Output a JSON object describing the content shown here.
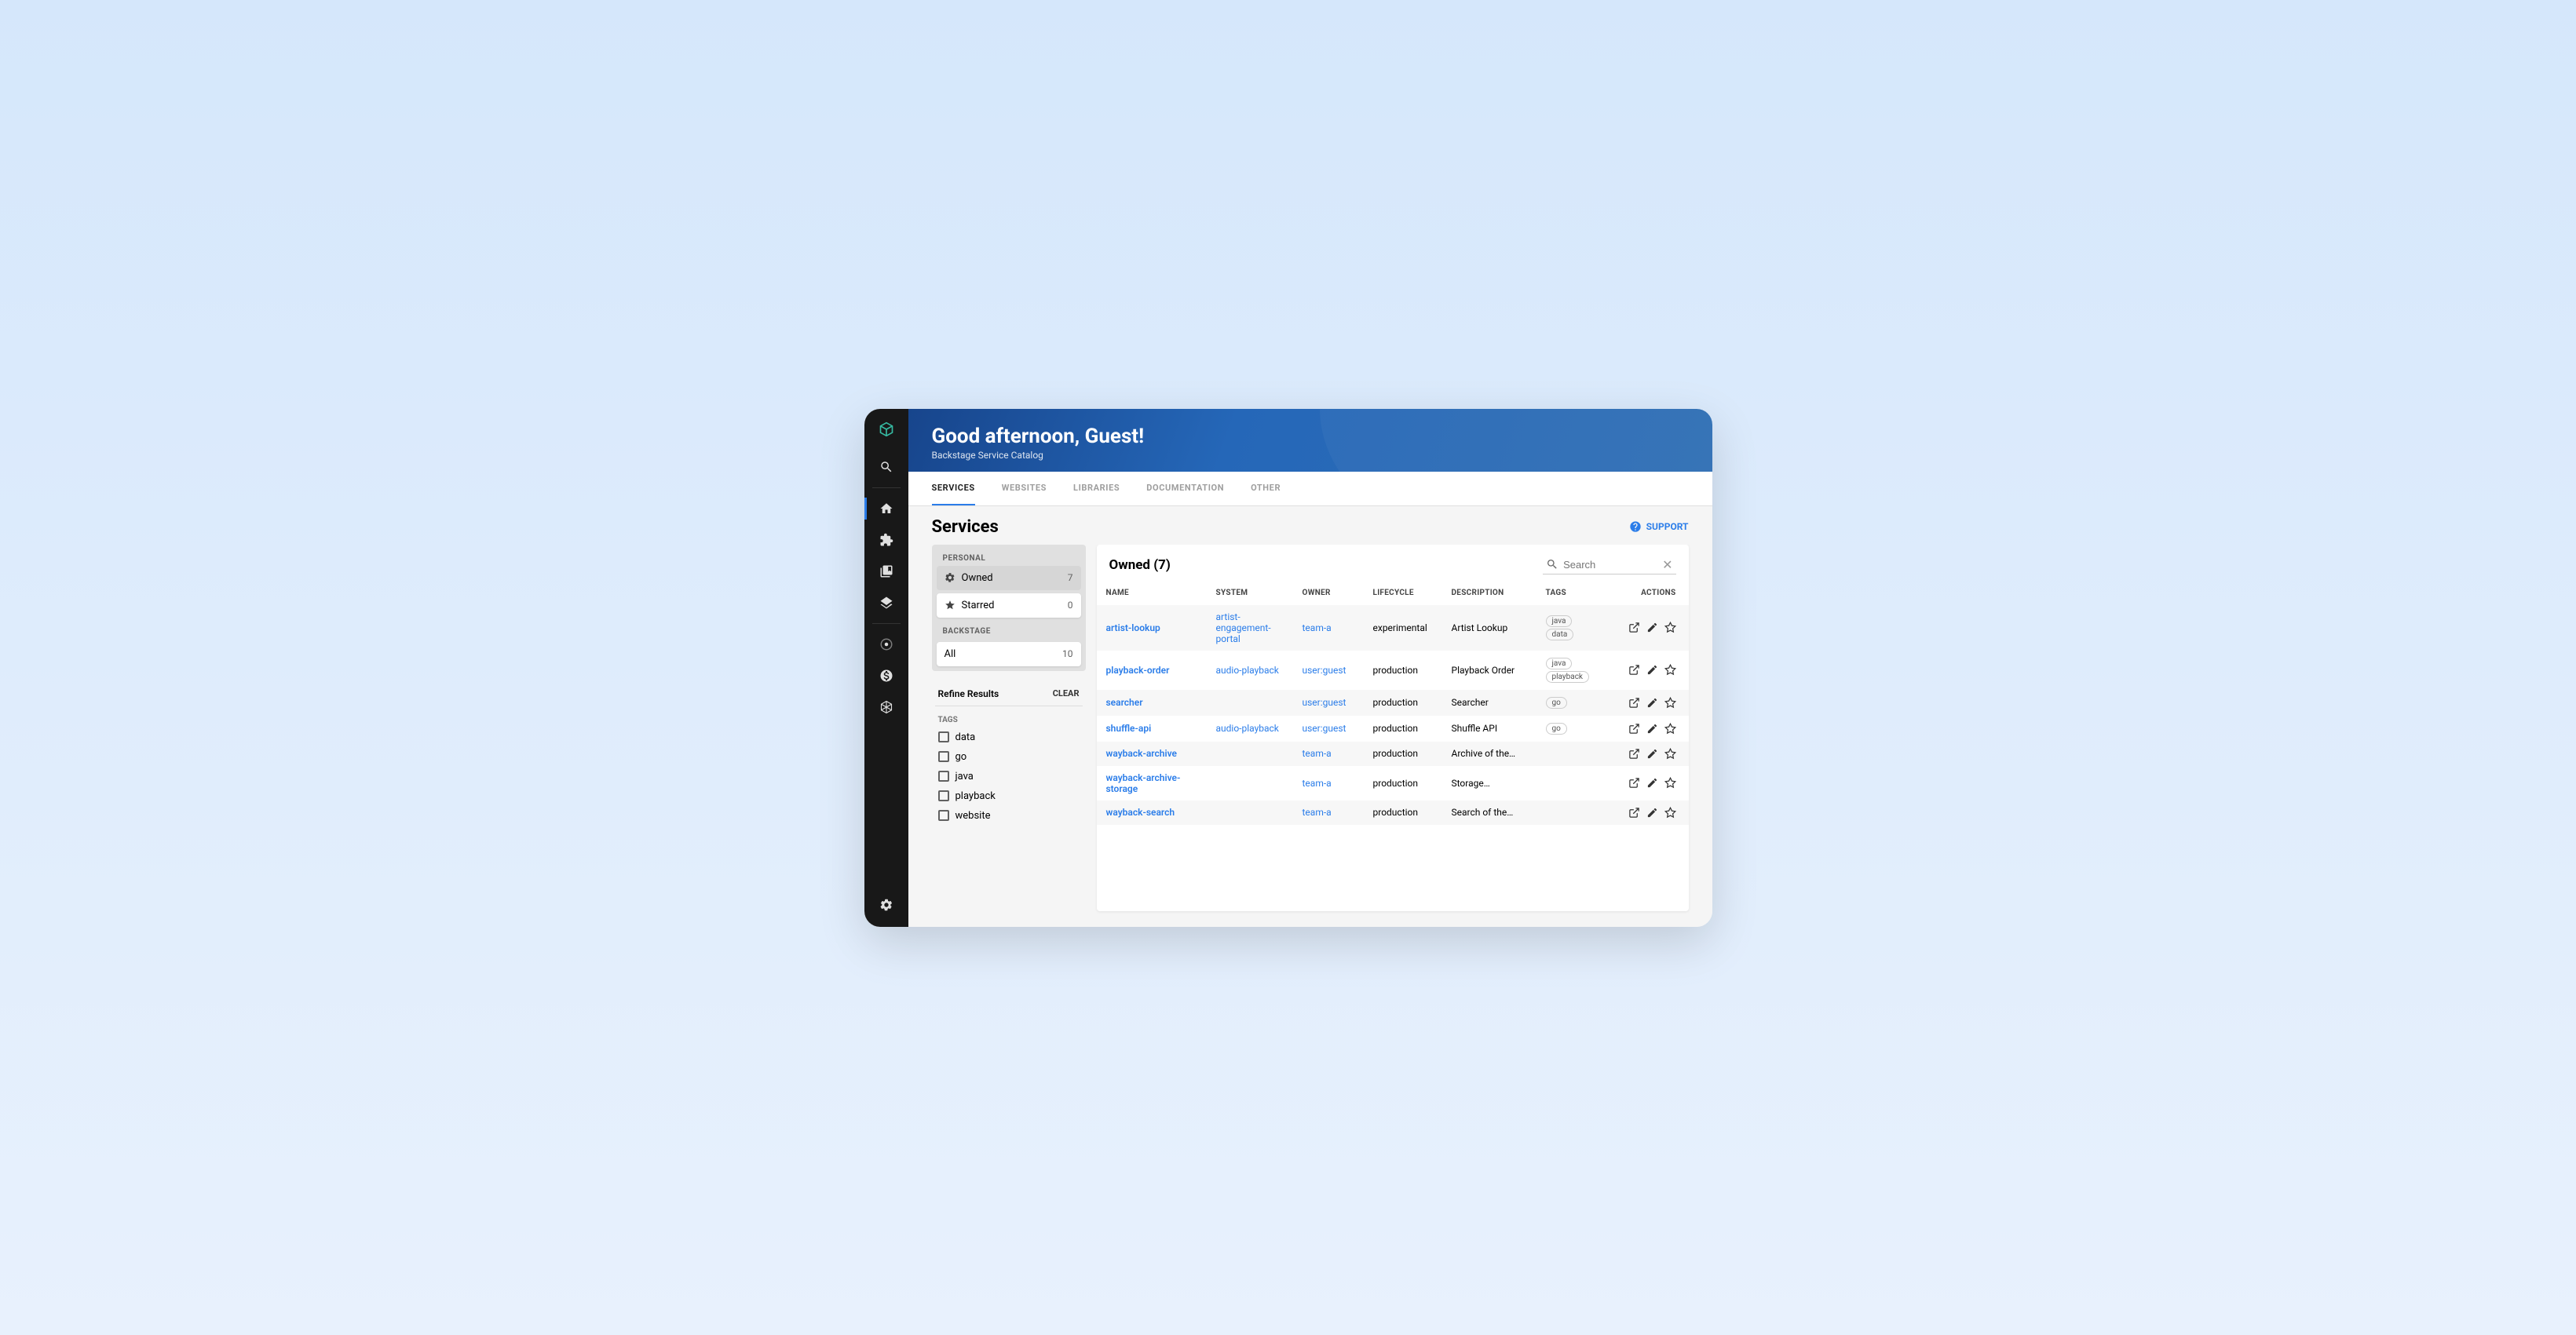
{
  "header": {
    "title": "Good afternoon, Guest!",
    "subtitle": "Backstage Service Catalog"
  },
  "tabs": [
    "SERVICES",
    "WEBSITES",
    "LIBRARIES",
    "DOCUMENTATION",
    "OTHER"
  ],
  "page_title": "Services",
  "support_label": "SUPPORT",
  "filters": {
    "personal_label": "PERSONAL",
    "owned": {
      "label": "Owned",
      "count": "7"
    },
    "starred": {
      "label": "Starred",
      "count": "0"
    },
    "backstage_label": "BACKSTAGE",
    "all": {
      "label": "All",
      "count": "10"
    }
  },
  "refine": {
    "title": "Refine Results",
    "clear": "CLEAR",
    "tags_label": "TAGS",
    "tags": [
      "data",
      "go",
      "java",
      "playback",
      "website"
    ]
  },
  "table": {
    "title": "Owned (7)",
    "search_placeholder": "Search",
    "columns": [
      "NAME",
      "SYSTEM",
      "OWNER",
      "LIFECYCLE",
      "DESCRIPTION",
      "TAGS",
      "ACTIONS"
    ],
    "rows": [
      {
        "name": "artist-lookup",
        "system": "artist-engagement-portal",
        "owner": "team-a",
        "lifecycle": "experimental",
        "description": "Artist Lookup",
        "tags": [
          "java",
          "data"
        ]
      },
      {
        "name": "playback-order",
        "system": "audio-playback",
        "owner": "user:guest",
        "lifecycle": "production",
        "description": "Playback Order",
        "tags": [
          "java",
          "playback"
        ]
      },
      {
        "name": "searcher",
        "system": "",
        "owner": "user:guest",
        "lifecycle": "production",
        "description": "Searcher",
        "tags": [
          "go"
        ]
      },
      {
        "name": "shuffle-api",
        "system": "audio-playback",
        "owner": "user:guest",
        "lifecycle": "production",
        "description": "Shuffle API",
        "tags": [
          "go"
        ]
      },
      {
        "name": "wayback-archive",
        "system": "",
        "owner": "team-a",
        "lifecycle": "production",
        "description": "Archive of the…",
        "tags": []
      },
      {
        "name": "wayback-archive-storage",
        "system": "",
        "owner": "team-a",
        "lifecycle": "production",
        "description": "Storage…",
        "tags": []
      },
      {
        "name": "wayback-search",
        "system": "",
        "owner": "team-a",
        "lifecycle": "production",
        "description": "Search of the…",
        "tags": []
      }
    ]
  }
}
